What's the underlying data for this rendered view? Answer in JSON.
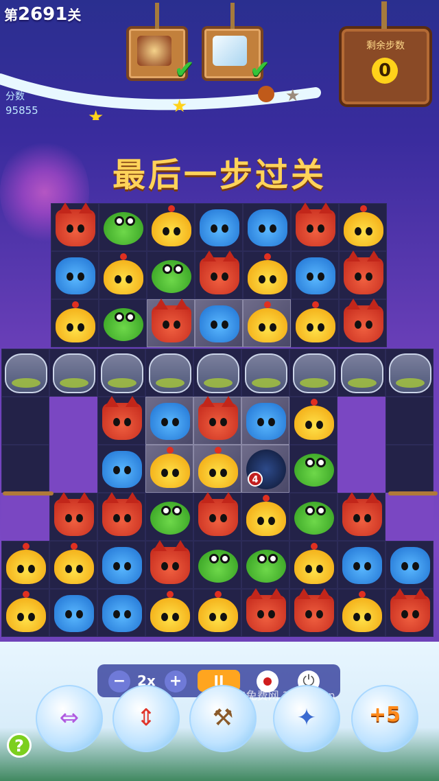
{
  "hud": {
    "level_prefix": "第",
    "level_number": "2691",
    "level_suffix": "关",
    "score_label": "分数",
    "score_value": "95855",
    "moves_label": "剩余步数",
    "moves_value": "0",
    "goals": [
      {
        "name": "cake",
        "icon": "cake-icon",
        "completed": true
      },
      {
        "name": "ice-block",
        "icon": "ice-block-icon",
        "completed": true
      }
    ],
    "check_glyph": "✔"
  },
  "banner": "最后一步过关",
  "board": {
    "rows": [
      [
        "fox",
        "frog",
        "chick",
        "bear",
        "bear",
        "fox",
        "chick"
      ],
      [
        "bear",
        "chick",
        "frog",
        "fox",
        "chick",
        "bear",
        "fox"
      ],
      [
        "chick",
        "frog",
        "fox",
        "bear",
        "chick",
        "chick",
        "fox"
      ],
      [
        "jar",
        "jar",
        "jar",
        "jar",
        "jar",
        "jar",
        "jar",
        "jar",
        "jar"
      ],
      [
        null,
        null,
        "fox",
        "bear",
        "fox",
        "bear",
        "chick",
        null,
        null
      ],
      [
        null,
        null,
        "bear",
        "chick",
        "chick",
        "bomb",
        "frog",
        null,
        null
      ],
      [
        null,
        "fox",
        "fox",
        "frog",
        "fox",
        "chick",
        "frog",
        "fox",
        null
      ],
      [
        "chick",
        "chick",
        "bear",
        "fox",
        "frog",
        "frog",
        "chick",
        "bear",
        "bear"
      ],
      [
        "chick",
        "bear",
        "bear",
        "chick",
        "chick",
        "fox",
        "fox",
        "chick",
        "fox"
      ]
    ],
    "bomb_count": "4"
  },
  "controls": {
    "minus": "−",
    "speed": "2x",
    "plus": "+",
    "pause": "II",
    "power": "⏻"
  },
  "boosters": [
    {
      "name": "rocket-horizontal-icon",
      "label": ""
    },
    {
      "name": "rocket-vertical-icon",
      "label": ""
    },
    {
      "name": "hammer-icon",
      "label": ""
    },
    {
      "name": "magic-wand-icon",
      "label": ""
    },
    {
      "name": "plus-five-moves-icon",
      "label": "+5"
    }
  ],
  "help": "?",
  "watermark": "3G免费网 3gmfw.cn"
}
